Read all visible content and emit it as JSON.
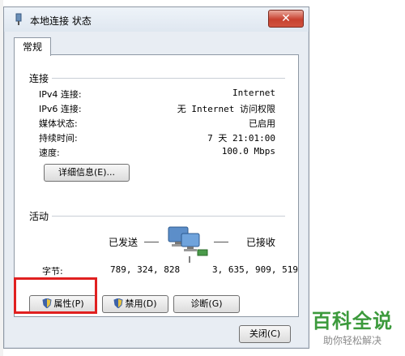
{
  "window": {
    "title": "本地连接 状态",
    "close_label": "✕"
  },
  "tabs": [
    {
      "label": "常规"
    }
  ],
  "connection": {
    "section_label": "连接",
    "rows": [
      {
        "label": "IPv4 连接:",
        "value": "Internet"
      },
      {
        "label": "IPv6 连接:",
        "value": "无 Internet 访问权限"
      },
      {
        "label": "媒体状态:",
        "value": "已启用"
      },
      {
        "label": "持续时间:",
        "value": "7 天 21:01:00"
      },
      {
        "label": "速度:",
        "value": "100.0 Mbps"
      }
    ],
    "details_button": "详细信息(E)..."
  },
  "activity": {
    "section_label": "活动",
    "sent_label": "已发送",
    "received_label": "已接收",
    "bytes_label": "字节:",
    "bytes_sent": "789, 324, 828",
    "bytes_received": "3, 635, 909, 519"
  },
  "buttons": {
    "properties": "属性(P)",
    "disable": "禁用(D)",
    "diagnose": "诊断(G)",
    "close": "关闭(C)"
  },
  "watermark": {
    "main": "百科全说",
    "sub": "助你轻松解决"
  },
  "colors": {
    "highlight": "#e02020",
    "watermark_green": "#3c9a3c"
  }
}
